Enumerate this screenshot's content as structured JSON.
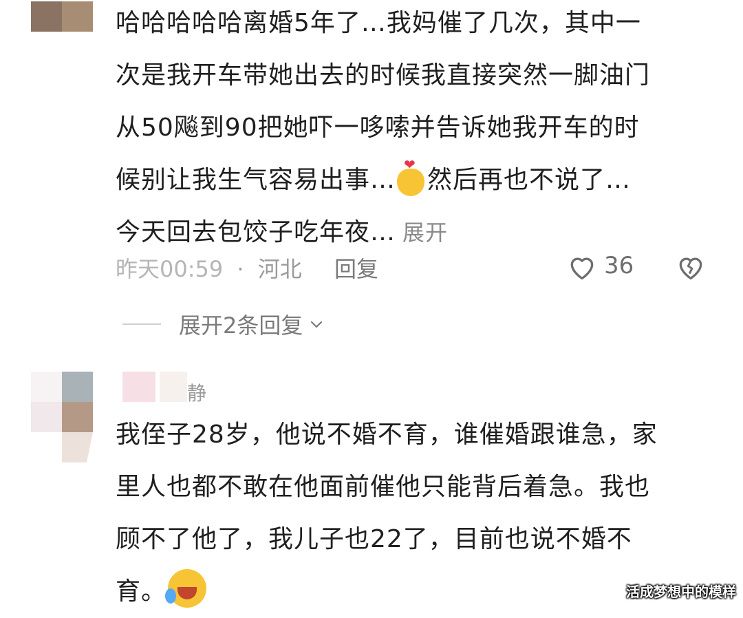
{
  "comment1": {
    "lines": [
      "哈哈哈哈哈离婚5年了…我妈催了几次，其中一",
      "次是我开车带她出去的时候我直接突然一脚油门",
      "从50飚到90把她吓一哆嗦并告诉她我开车的时",
      "候别让我生气容易出事…",
      "然后再也不说了…",
      "今天回去包饺子吃年夜…"
    ],
    "expand_label": "展开",
    "time": "昨天00:59",
    "separator": "·",
    "location": "河北",
    "reply_label": "回复",
    "like_count": "36",
    "expand_replies_label": "展开2条回复"
  },
  "comment2": {
    "nickname": "静",
    "lines": [
      "我侄子28岁，他说不婚不育，谁催婚跟谁急，家",
      "里人也都不敢在他面前催他只能背后着急。我也",
      "顾不了他了，我儿子也22了，目前也说不婚不",
      "育。"
    ]
  },
  "icons": {
    "like": "heart-outline-icon",
    "dislike": "broken-heart-icon",
    "expand": "chevron-down-icon",
    "emoji1": "finger-heart-emoji",
    "emoji2": "rofl-emoji"
  },
  "watermark": "活成梦想中的模样",
  "colors": {
    "text": "#1f1f1f",
    "meta": "#9b9b9b",
    "emoji_yellow": "#f7c436",
    "heart_red": "#e8354a"
  }
}
